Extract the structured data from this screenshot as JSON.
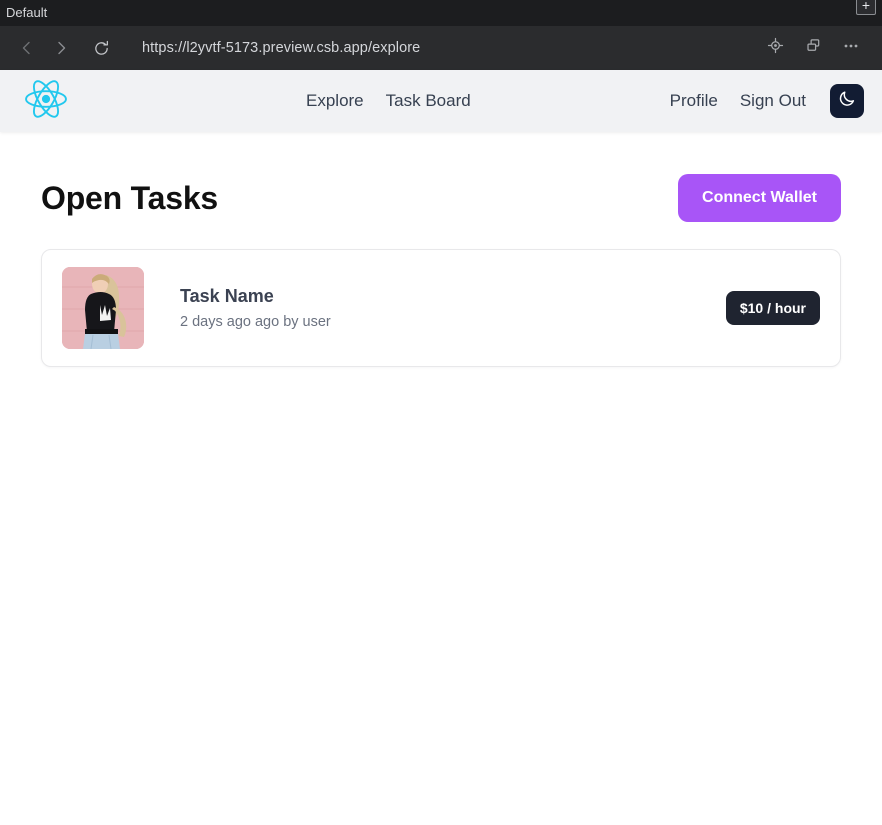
{
  "browser": {
    "profile_label": "Default",
    "new_tab_label": "+",
    "url": "https://l2yvtf-5173.preview.csb.app/explore",
    "icons": {
      "back": "back-arrow-icon",
      "forward": "forward-arrow-icon",
      "reload": "reload-icon",
      "capture": "capture-target-icon",
      "split": "split-window-icon",
      "menu": "more-options-icon"
    }
  },
  "app_header": {
    "logo": "react-logo-icon",
    "logo_color": "#22c8ee",
    "nav_left": [
      {
        "label": "Explore"
      },
      {
        "label": "Task Board"
      }
    ],
    "nav_right": [
      {
        "label": "Profile"
      },
      {
        "label": "Sign Out"
      }
    ],
    "theme_toggle": {
      "icon": "moon-icon",
      "background": "#121c33"
    }
  },
  "main": {
    "title": "Open Tasks",
    "connect_wallet_label": "Connect Wallet",
    "connect_wallet_color": "#a855f7",
    "tasks": [
      {
        "thumbnail": "person-photo-thumbnail",
        "name": "Task Name",
        "meta": "2 days ago ago by user",
        "rate": "$10 / hour",
        "rate_color": "#1f2430"
      }
    ]
  }
}
